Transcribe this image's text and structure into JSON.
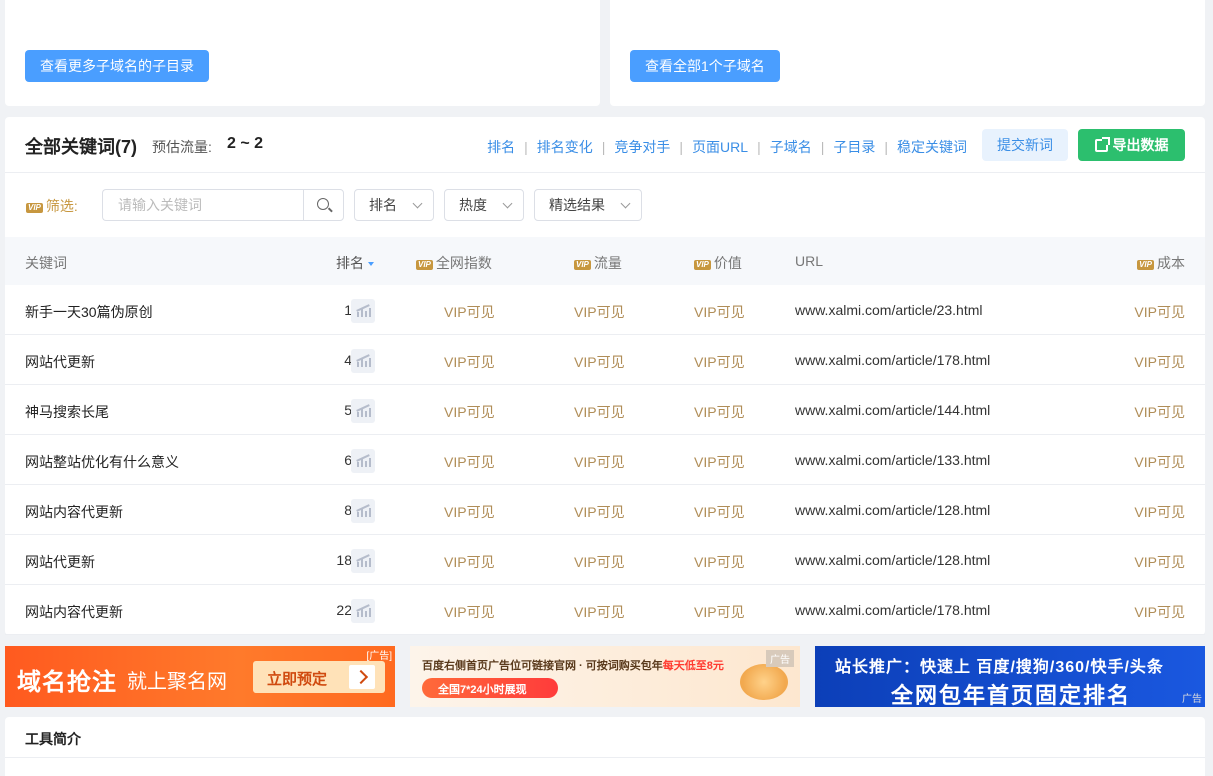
{
  "subdomain_card": {
    "button_label": "查看更多子域名的子目录"
  },
  "subdomain_all_card": {
    "button_label": "查看全部1个子域名"
  },
  "keywords": {
    "title": "全部关键词(7)",
    "flow_label": "预估流量:",
    "flow_value": "2 ~ 2",
    "nav_links": [
      "排名",
      "排名变化",
      "竞争对手",
      "页面URL",
      "子域名",
      "子目录",
      "稳定关键词"
    ],
    "submit_label": "提交新词",
    "export_label": "导出数据"
  },
  "filter": {
    "vip_badge": "VIP",
    "label": "筛选:",
    "search_placeholder": "请输入关键词",
    "dropdowns": [
      "排名",
      "热度",
      "精选结果"
    ]
  },
  "table": {
    "headers": {
      "keyword": "关键词",
      "rank": "排名",
      "index": "全网指数",
      "traffic": "流量",
      "value": "价值",
      "url": "URL",
      "cost": "成本"
    },
    "vip_placeholder": "VIP可见",
    "rows": [
      {
        "keyword": "新手一天30篇伪原创",
        "rank": "1",
        "url": "www.xalmi.com/article/23.html"
      },
      {
        "keyword": "网站代更新",
        "rank": "4",
        "url": "www.xalmi.com/article/178.html"
      },
      {
        "keyword": "神马搜索长尾",
        "rank": "5",
        "url": "www.xalmi.com/article/144.html"
      },
      {
        "keyword": "网站整站优化有什么意义",
        "rank": "6",
        "url": "www.xalmi.com/article/133.html"
      },
      {
        "keyword": "网站内容代更新",
        "rank": "8",
        "url": "www.xalmi.com/article/128.html"
      },
      {
        "keyword": "网站代更新",
        "rank": "18",
        "url": "www.xalmi.com/article/128.html"
      },
      {
        "keyword": "网站内容代更新",
        "rank": "22",
        "url": "www.xalmi.com/article/178.html"
      }
    ]
  },
  "ads": {
    "ad1": {
      "main": "域名抢注",
      "sub": "就上聚名网",
      "cta": "立即预定",
      "tag": "[广告]"
    },
    "ad2": {
      "line1_prefix": "百度右侧首页广告位可链接官网 · 可按词购买包年",
      "line1_highlight": "每天低至8元",
      "pill": "全国7*24小时展现",
      "tag": "广告"
    },
    "ad3": {
      "line1": "站长推广：快速上 百度/搜狗/360/快手/头条",
      "line2": "全网包年首页固定排名",
      "tag": "广告"
    }
  },
  "intro": {
    "title": "工具简介"
  }
}
